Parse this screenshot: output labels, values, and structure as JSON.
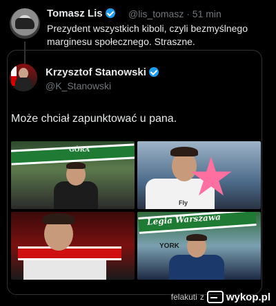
{
  "tweet": {
    "author_name": "Tomasz Lis",
    "handle": "@lis_tomasz",
    "time": "· 51 min",
    "text": "Prezydent wszystkich kiboli, czyli bezmyślnego marginesu społecznego. Straszne."
  },
  "quoted": {
    "author_name": "Krzysztof Stanowski",
    "handle": "@K_Stanowski",
    "text": "Może chciał zapunktować u pana."
  },
  "photos": [
    {
      "caption": "GÓRA"
    },
    {
      "caption": "Fly"
    },
    {
      "caption": ""
    },
    {
      "caption": "Legia Warszawa",
      "caption2": "YORK"
    }
  ],
  "footer": {
    "uploader": "felakuti",
    "connector": "z",
    "brand": "wykop.pl"
  },
  "colors": {
    "verified": "#1d9bf0",
    "background": "#000000",
    "secondary_text": "#71767b"
  }
}
